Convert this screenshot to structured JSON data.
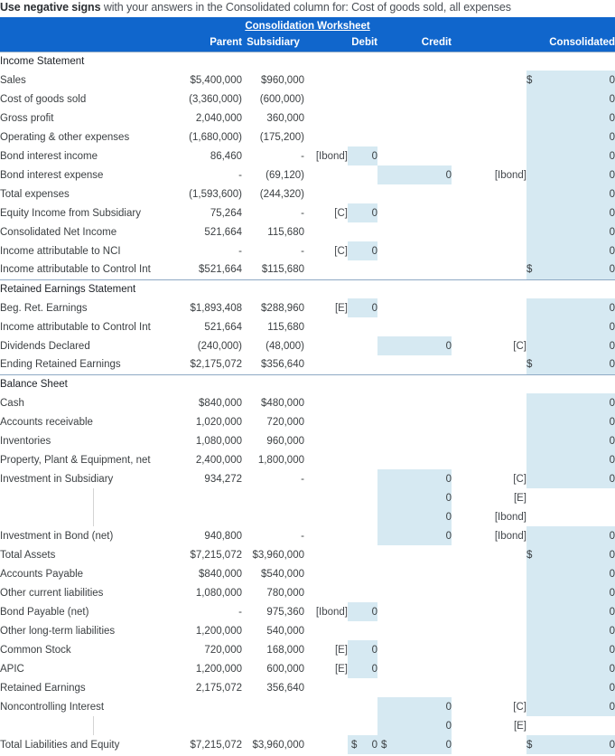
{
  "instruction": {
    "bold": "Use negative signs",
    "rest": " with your answers in the Consolidated column for: Cost of goods sold, all expenses"
  },
  "header": {
    "title": "Consolidation Worksheet",
    "col_parent": "Parent",
    "col_subsidiary": "Subsidiary",
    "col_debit": "Debit",
    "col_credit": "Credit",
    "col_consolidated": "Consolidated"
  },
  "colors": {
    "band": "#1066cc",
    "input_fill": "#d6e9f2",
    "grid": "#d4d4d4",
    "rule": "#333a41"
  },
  "sections": [
    {
      "name": "Income Statement"
    },
    {
      "name": "Retained Earnings Statement"
    },
    {
      "name": "Balance Sheet"
    }
  ],
  "rows": [
    {
      "id": "sec-income",
      "type": "section",
      "label": "Income Statement"
    },
    {
      "id": "sales",
      "type": "data",
      "label": "Sales",
      "parent": "$5,400,000",
      "sub": "$960,000",
      "dref": "",
      "debit": "",
      "credit": "",
      "cref": "",
      "cdollar": "$",
      "cons": "0"
    },
    {
      "id": "cogs",
      "type": "data",
      "label": "Cost of goods sold",
      "parent": "(3,360,000)",
      "sub": "(600,000)",
      "dref": "",
      "debit": "",
      "credit": "",
      "cref": "",
      "cdollar": "",
      "cons": "0"
    },
    {
      "id": "gross-profit",
      "type": "data",
      "label": "Gross profit",
      "parent": "2,040,000",
      "sub": "360,000",
      "dref": "",
      "debit": "",
      "credit": "",
      "cref": "",
      "cdollar": "",
      "cons": "0"
    },
    {
      "id": "opex",
      "type": "data",
      "label": "Operating & other expenses",
      "parent": "(1,680,000)",
      "sub": "(175,200)",
      "dref": "",
      "debit": "",
      "credit": "",
      "cref": "",
      "cdollar": "",
      "cons": "0"
    },
    {
      "id": "bond-int-inc",
      "type": "data",
      "label": "Bond interest income",
      "parent": "86,460",
      "sub": "-",
      "dref": "[Ibond]",
      "debit": "0",
      "credit": "",
      "cref": "",
      "cdollar": "",
      "cons": "0"
    },
    {
      "id": "bond-int-exp",
      "type": "data",
      "label": "Bond interest expense",
      "parent": "-",
      "sub": "(69,120)",
      "dref": "",
      "debit": "",
      "credit": "0",
      "cref": "[Ibond]",
      "cdollar": "",
      "cons": "0"
    },
    {
      "id": "total-exp",
      "type": "data",
      "label": "Total expenses",
      "parent": "(1,593,600)",
      "sub": "(244,320)",
      "dref": "",
      "debit": "",
      "credit": "",
      "cref": "",
      "cdollar": "",
      "cons": "0"
    },
    {
      "id": "equity-income",
      "type": "data",
      "label": "Equity Income from Subsidiary",
      "parent": "75,264",
      "sub": "-",
      "dref": "[C]",
      "debit": "0",
      "credit": "",
      "cref": "",
      "cdollar": "",
      "cons": "0"
    },
    {
      "id": "cons-net-inc",
      "type": "data",
      "label": "Consolidated Net Income",
      "parent": "521,664",
      "sub": "115,680",
      "dref": "",
      "debit": "",
      "credit": "",
      "cref": "",
      "cdollar": "",
      "cons": "0"
    },
    {
      "id": "inc-nci",
      "type": "data",
      "label": "Income attributable to NCI",
      "parent": "-",
      "sub": "-",
      "dref": "[C]",
      "debit": "0",
      "credit": "",
      "cref": "",
      "cdollar": "",
      "cons": "0"
    },
    {
      "id": "inc-ctrl-is",
      "type": "data",
      "label": "Income attributable to Control Int",
      "parent": "$521,664",
      "sub": "$115,680",
      "dref": "",
      "debit": "",
      "credit": "",
      "cref": "",
      "cdollar": "$",
      "cons": "0"
    },
    {
      "id": "sec-re",
      "type": "section",
      "label": "Retained Earnings Statement"
    },
    {
      "id": "beg-re",
      "type": "data",
      "label": "Beg. Ret. Earnings",
      "parent": "$1,893,408",
      "sub": "$288,960",
      "dref": "[E]",
      "debit": "0",
      "credit": "",
      "cref": "",
      "cdollar": "",
      "cons": "0"
    },
    {
      "id": "inc-ctrl-re",
      "type": "data",
      "label": "Income attributable to Control Int",
      "parent": "521,664",
      "sub": "115,680",
      "dref": "",
      "debit": "",
      "credit": "",
      "cref": "",
      "cdollar": "",
      "cons": "0"
    },
    {
      "id": "dividends",
      "type": "data",
      "label": "Dividends Declared",
      "parent": "(240,000)",
      "sub": "(48,000)",
      "dref": "",
      "debit": "",
      "credit": "0",
      "cref": "[C]",
      "cdollar": "",
      "cons": "0"
    },
    {
      "id": "end-re",
      "type": "data",
      "label": "Ending Retained Earnings",
      "parent": "$2,175,072",
      "sub": "$356,640",
      "dref": "",
      "debit": "",
      "credit": "",
      "cref": "",
      "cdollar": "$",
      "cons": "0"
    },
    {
      "id": "sec-bs",
      "type": "section",
      "label": "Balance Sheet"
    },
    {
      "id": "cash",
      "type": "data",
      "label": "Cash",
      "parent": "$840,000",
      "sub": "$480,000",
      "dref": "",
      "debit": "",
      "credit": "",
      "cref": "",
      "cdollar": "",
      "cons": "0"
    },
    {
      "id": "ar",
      "type": "data",
      "label": "Accounts receivable",
      "parent": "1,020,000",
      "sub": "720,000",
      "dref": "",
      "debit": "",
      "credit": "",
      "cref": "",
      "cdollar": "",
      "cons": "0"
    },
    {
      "id": "inventories",
      "type": "data",
      "label": "Inventories",
      "parent": "1,080,000",
      "sub": "960,000",
      "dref": "",
      "debit": "",
      "credit": "",
      "cref": "",
      "cdollar": "",
      "cons": "0"
    },
    {
      "id": "ppe",
      "type": "data",
      "label": "Property, Plant & Equipment, net",
      "parent": "2,400,000",
      "sub": "1,800,000",
      "dref": "",
      "debit": "",
      "credit": "",
      "cref": "",
      "cdollar": "",
      "cons": "0"
    },
    {
      "id": "inv-sub",
      "type": "data",
      "label": "Investment in Subsidiary",
      "parent": "934,272",
      "sub": "-",
      "dref": "",
      "debit": "",
      "credit": "0",
      "cref": "[C]",
      "cdollar": "",
      "cons": "0"
    },
    {
      "id": "inv-sub-e",
      "type": "blank",
      "label": "",
      "parent": "",
      "sub": "",
      "dref": "",
      "debit": "",
      "credit": "0",
      "cref": "[E]",
      "cdollar": "",
      "cons": ""
    },
    {
      "id": "inv-sub-ibond",
      "type": "blank",
      "label": "",
      "parent": "",
      "sub": "",
      "dref": "",
      "debit": "",
      "credit": "0",
      "cref": "[Ibond]",
      "cdollar": "",
      "cons": ""
    },
    {
      "id": "inv-bond",
      "type": "data",
      "label": "Investment in Bond (net)",
      "parent": "940,800",
      "sub": "-",
      "dref": "",
      "debit": "",
      "credit": "0",
      "cref": "[Ibond]",
      "cdollar": "",
      "cons": "0"
    },
    {
      "id": "total-assets",
      "type": "data",
      "label": "Total Assets",
      "parent": "$7,215,072",
      "sub": "$3,960,000",
      "dref": "",
      "debit": "",
      "credit": "",
      "cref": "",
      "cdollar": "$",
      "cons": "0"
    },
    {
      "id": "ap",
      "type": "data",
      "label": "Accounts Payable",
      "parent": "$840,000",
      "sub": "$540,000",
      "dref": "",
      "debit": "",
      "credit": "",
      "cref": "",
      "cdollar": "",
      "cons": "0"
    },
    {
      "id": "ocl",
      "type": "data",
      "label": "Other current liabilities",
      "parent": "1,080,000",
      "sub": "780,000",
      "dref": "",
      "debit": "",
      "credit": "",
      "cref": "",
      "cdollar": "",
      "cons": "0"
    },
    {
      "id": "bond-payable",
      "type": "data",
      "label": "Bond Payable (net)",
      "parent": "-",
      "sub": "975,360",
      "dref": "[Ibond]",
      "debit": "0",
      "credit": "",
      "cref": "",
      "cdollar": "",
      "cons": "0"
    },
    {
      "id": "oltl",
      "type": "data",
      "label": "Other long-term liabilities",
      "parent": "1,200,000",
      "sub": "540,000",
      "dref": "",
      "debit": "",
      "credit": "",
      "cref": "",
      "cdollar": "",
      "cons": "0"
    },
    {
      "id": "common-stock",
      "type": "data",
      "label": "Common Stock",
      "parent": "720,000",
      "sub": "168,000",
      "dref": "[E]",
      "debit": "0",
      "credit": "",
      "cref": "",
      "cdollar": "",
      "cons": "0"
    },
    {
      "id": "apic",
      "type": "data",
      "label": "APIC",
      "parent": "1,200,000",
      "sub": "600,000",
      "dref": "[E]",
      "debit": "0",
      "credit": "",
      "cref": "",
      "cdollar": "",
      "cons": "0"
    },
    {
      "id": "re-bs",
      "type": "data",
      "label": "Retained Earnings",
      "parent": "2,175,072",
      "sub": "356,640",
      "dref": "",
      "debit": "",
      "credit": "",
      "cref": "",
      "cdollar": "",
      "cons": "0"
    },
    {
      "id": "nci",
      "type": "data",
      "label": "Noncontrolling Interest",
      "parent": "",
      "sub": "",
      "dref": "",
      "debit": "",
      "credit": "0",
      "cref": "[C]",
      "cdollar": "",
      "cons": "0"
    },
    {
      "id": "nci-e",
      "type": "blank",
      "label": "",
      "parent": "",
      "sub": "",
      "dref": "",
      "debit": "",
      "credit": "0",
      "cref": "[E]",
      "cdollar": "",
      "cons": ""
    },
    {
      "id": "total-le",
      "type": "data",
      "label": "Total Liabilities and Equity",
      "parent": "$7,215,072",
      "sub": "$3,960,000",
      "dref": "",
      "ddollar": "$",
      "debit": "0",
      "cdollar2": "$",
      "credit": "0",
      "cref": "",
      "cdollar": "$",
      "cons": "0"
    }
  ]
}
